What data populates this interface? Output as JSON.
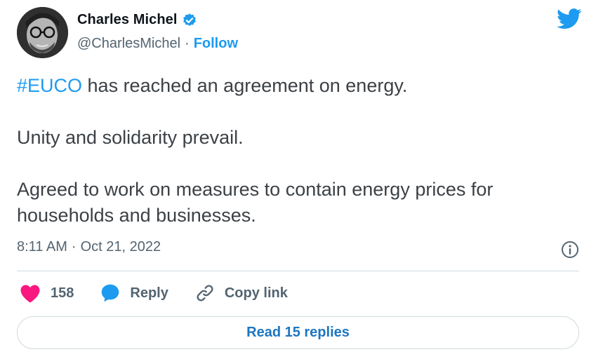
{
  "author": {
    "display_name": "Charles Michel",
    "handle": "@CharlesMichel",
    "separator": "·",
    "follow_label": "Follow",
    "verified": true
  },
  "tweet": {
    "hashtag": "#EUCO",
    "line1_rest": " has reached an agreement on energy.",
    "line2": "Unity and solidarity prevail.",
    "line3": "Agreed to work on measures to contain energy prices for households and businesses."
  },
  "meta": {
    "time": "8:11 AM",
    "separator": "·",
    "date": "Oct 21, 2022"
  },
  "actions": {
    "like_count": "158",
    "reply_label": "Reply",
    "copy_link_label": "Copy link"
  },
  "read_replies_label": "Read 15 replies",
  "colors": {
    "accent": "#1d9bf0",
    "like": "#f91880",
    "text": "#0f1419",
    "secondary": "#536471",
    "border": "#cfd9de"
  },
  "icons": {
    "brand": "twitter-bird-icon",
    "verified": "verified-badge-icon",
    "info": "info-icon",
    "like": "heart-icon",
    "reply": "speech-bubble-icon",
    "copy_link": "link-icon"
  }
}
